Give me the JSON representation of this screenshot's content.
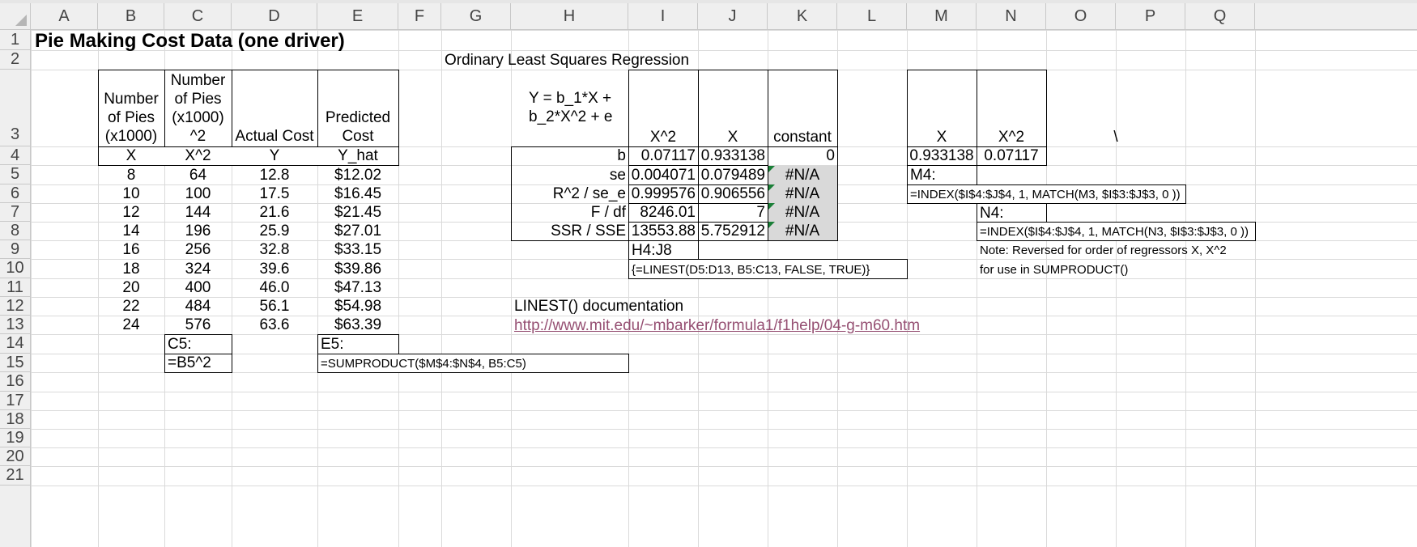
{
  "columns": [
    "A",
    "B",
    "C",
    "D",
    "E",
    "F",
    "G",
    "H",
    "I",
    "J",
    "K",
    "L",
    "M",
    "N",
    "O",
    "P",
    "Q"
  ],
  "rows": [
    "1",
    "2",
    "3",
    "4",
    "5",
    "6",
    "7",
    "8",
    "9",
    "10",
    "11",
    "12",
    "13",
    "14",
    "15",
    "16",
    "17",
    "18",
    "19",
    "20",
    "21"
  ],
  "title": "Pie Making Cost Data (one driver)",
  "ols_title": "Ordinary Least Squares Regression",
  "table1": {
    "h_b": [
      "Number",
      "of Pies",
      "(x1000)"
    ],
    "h_c": [
      "Number",
      "of Pies",
      "(x1000)",
      "^2"
    ],
    "h_d": "Actual Cost",
    "h_e": [
      "Predicted",
      "Cost"
    ],
    "sub": [
      "X",
      "X^2",
      "Y",
      "Y_hat"
    ],
    "rows": [
      [
        "8",
        "64",
        "12.8",
        "$12.02"
      ],
      [
        "10",
        "100",
        "17.5",
        "$16.45"
      ],
      [
        "12",
        "144",
        "21.6",
        "$21.45"
      ],
      [
        "14",
        "196",
        "25.9",
        "$27.01"
      ],
      [
        "16",
        "256",
        "32.8",
        "$33.15"
      ],
      [
        "18",
        "324",
        "39.6",
        "$39.86"
      ],
      [
        "20",
        "400",
        "46.0",
        "$47.13"
      ],
      [
        "22",
        "484",
        "56.1",
        "$54.98"
      ],
      [
        "24",
        "576",
        "63.6",
        "$63.39"
      ]
    ]
  },
  "notes": {
    "c14": "C5:",
    "c15": "=B5^2",
    "e14": "E5:",
    "e15": "=SUMPRODUCT($M$4:$N$4, B5:C5)",
    "i9": "H4:J8",
    "i10": "{=LINEST(D5:D13, B5:C13, FALSE, TRUE)}",
    "h12": "LINEST() documentation",
    "h13": "http://www.mit.edu/~mbarker/formula1/f1help/04-g-m60.htm",
    "m5": "M4:",
    "m6": "=INDEX($I$4:$J$4, 1, MATCH(M3, $I$3:$J$3, 0 ))",
    "n7": "N4:",
    "n8": "=INDEX($I$4:$J$4, 1, MATCH(N3, $I$3:$J$3, 0 ))",
    "n9": "Note: Reversed for order of regressors X, X^2",
    "n10": "for use in SUMPRODUCT()"
  },
  "regression": {
    "equation": [
      "Y = b_1*X +",
      "b_2*X^2 + e"
    ],
    "col_headers": [
      "X^2",
      "X",
      "constant"
    ],
    "rows": [
      {
        "label": "b",
        "v": [
          "0.07117",
          "0.933138",
          "0"
        ]
      },
      {
        "label": "se",
        "v": [
          "0.004071",
          "0.079489",
          "#N/A"
        ]
      },
      {
        "label": "R^2 / se_e",
        "v": [
          "0.999576",
          "0.906556",
          "#N/A"
        ]
      },
      {
        "label": "F / df",
        "v": [
          "8246.01",
          "7",
          "#N/A"
        ]
      },
      {
        "label": "SSR / SSE",
        "v": [
          "13553.88",
          "5.752912",
          "#N/A"
        ]
      }
    ]
  },
  "reordered": {
    "headers": [
      "X",
      "X^2"
    ],
    "values": [
      "0.933138",
      "0.07117"
    ],
    "o3": "\\"
  },
  "colors": {
    "link": "#954f72",
    "shade": "#d9d9d9",
    "error_marker": "#1a7f37",
    "header_bg": "#efefef"
  }
}
